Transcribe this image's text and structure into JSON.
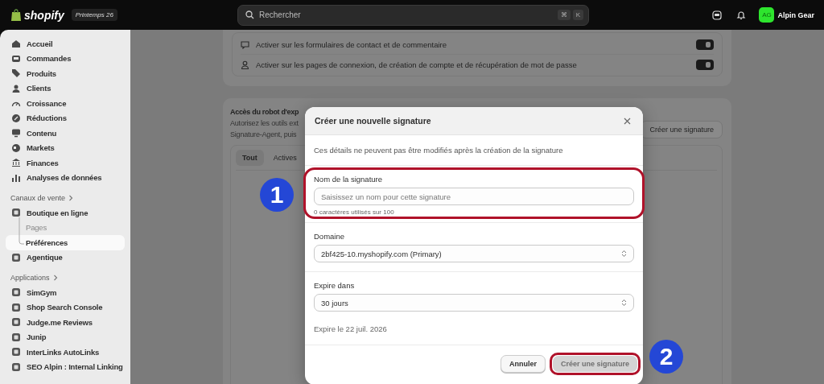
{
  "topbar": {
    "brand": "shopify",
    "edition": "Printemps 26",
    "search": {
      "placeholder": "Rechercher",
      "keys": [
        "⌘",
        "K"
      ]
    },
    "avatar": "AG",
    "store": "Alpin Gear"
  },
  "sidebar": {
    "groups": [
      {
        "items": [
          {
            "label": "Accueil",
            "selected": false
          },
          {
            "label": "Commandes",
            "selected": false
          },
          {
            "label": "Produits",
            "selected": false
          },
          {
            "label": "Clients",
            "selected": false
          },
          {
            "label": "Croissance",
            "selected": false
          },
          {
            "label": "Réductions",
            "selected": false
          },
          {
            "label": "Contenu",
            "selected": false
          },
          {
            "label": "Markets",
            "selected": false
          },
          {
            "label": "Finances",
            "selected": false
          },
          {
            "label": "Analyses de données",
            "selected": false
          }
        ]
      },
      {
        "heading": "Canaux de vente",
        "items": [
          {
            "label": "Boutique en ligne",
            "selected": false,
            "children": [
              {
                "label": "Pages",
                "selected": false
              },
              {
                "label": "Préférences",
                "selected": true
              }
            ]
          },
          {
            "label": "Agentique",
            "selected": false
          }
        ]
      },
      {
        "heading": "Applications",
        "items": [
          {
            "label": "SimGym",
            "selected": false
          },
          {
            "label": "Shop Search Console",
            "selected": false
          },
          {
            "label": "Judge.me Reviews",
            "selected": false
          },
          {
            "label": "Junip",
            "selected": false
          },
          {
            "label": "InterLinks AutoLinks",
            "selected": false
          },
          {
            "label": "SEO Alpin : Internal Linking",
            "selected": false
          }
        ]
      }
    ]
  },
  "cards": [
    {
      "toggles": [
        {
          "label": "Activer sur les formulaires de contact et de commentaire",
          "on": true
        },
        {
          "label": "Activer sur les pages de connexion, de création de compte et de récupération de mot de passe",
          "on": true
        }
      ]
    },
    {
      "title": "Accès du robot d'exp",
      "description": [
        "Autorisez les outils ext",
        "Signature-Agent, puis"
      ],
      "button": "Créer une signature",
      "tabs": [
        {
          "label": "Tout",
          "selected": true
        },
        {
          "label": "Actives",
          "selected": false
        }
      ]
    }
  ],
  "modal": {
    "title": "Créer une nouvelle signature",
    "note": "Ces détails ne peuvent pas être modifiés après la création de la signature",
    "fields": [
      {
        "kind": "text",
        "label": "Nom de la signature",
        "placeholder": "Saisissez un nom pour cette signature",
        "help": "0 caractères utilisés sur 100",
        "highlighted": true
      },
      {
        "kind": "select",
        "label": "Domaine",
        "value": "2bf425-10.myshopify.com (Primary)",
        "highlighted": false
      },
      {
        "kind": "select",
        "label": "Expire dans",
        "value": "30 jours",
        "help": "Expire le 22 juil. 2026",
        "highlighted": false
      }
    ],
    "buttons": [
      {
        "label": "Annuler",
        "kind": "secondary",
        "disabled": false,
        "highlighted": false
      },
      {
        "label": "Créer une signature",
        "kind": "primary",
        "disabled": true,
        "highlighted": true
      }
    ]
  },
  "annotations": [
    {
      "number": "1"
    },
    {
      "number": "2"
    }
  ]
}
